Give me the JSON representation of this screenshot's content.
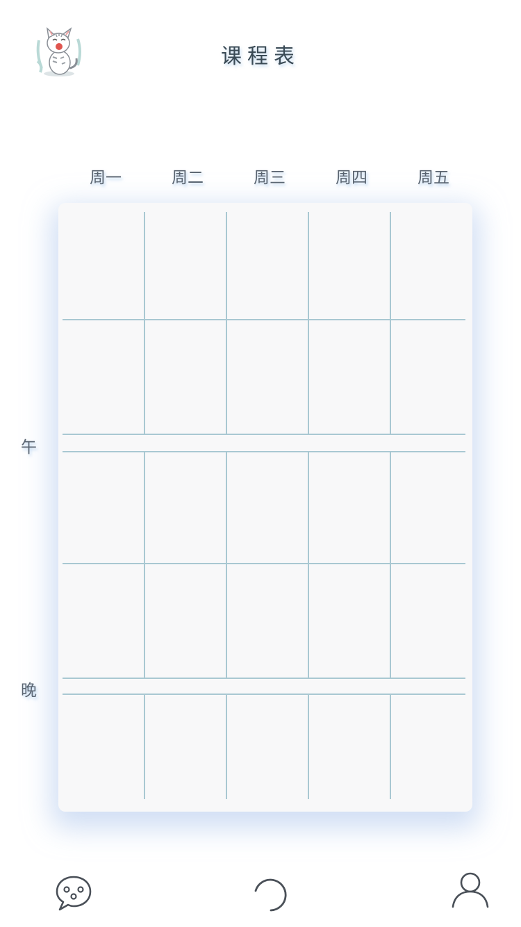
{
  "header": {
    "title": "课程表",
    "avatar_icon": "cat-avatar-icon"
  },
  "days": [
    "周一",
    "周二",
    "周三",
    "周四",
    "周五"
  ],
  "periods": {
    "noon_label": "午",
    "evening_label": "晚"
  },
  "grid_color": "#a9c8d2",
  "tabbar": {
    "items": [
      {
        "icon": "chat-bubble-icon"
      },
      {
        "icon": "loading-spinner-icon"
      },
      {
        "icon": "user-profile-icon"
      }
    ]
  }
}
